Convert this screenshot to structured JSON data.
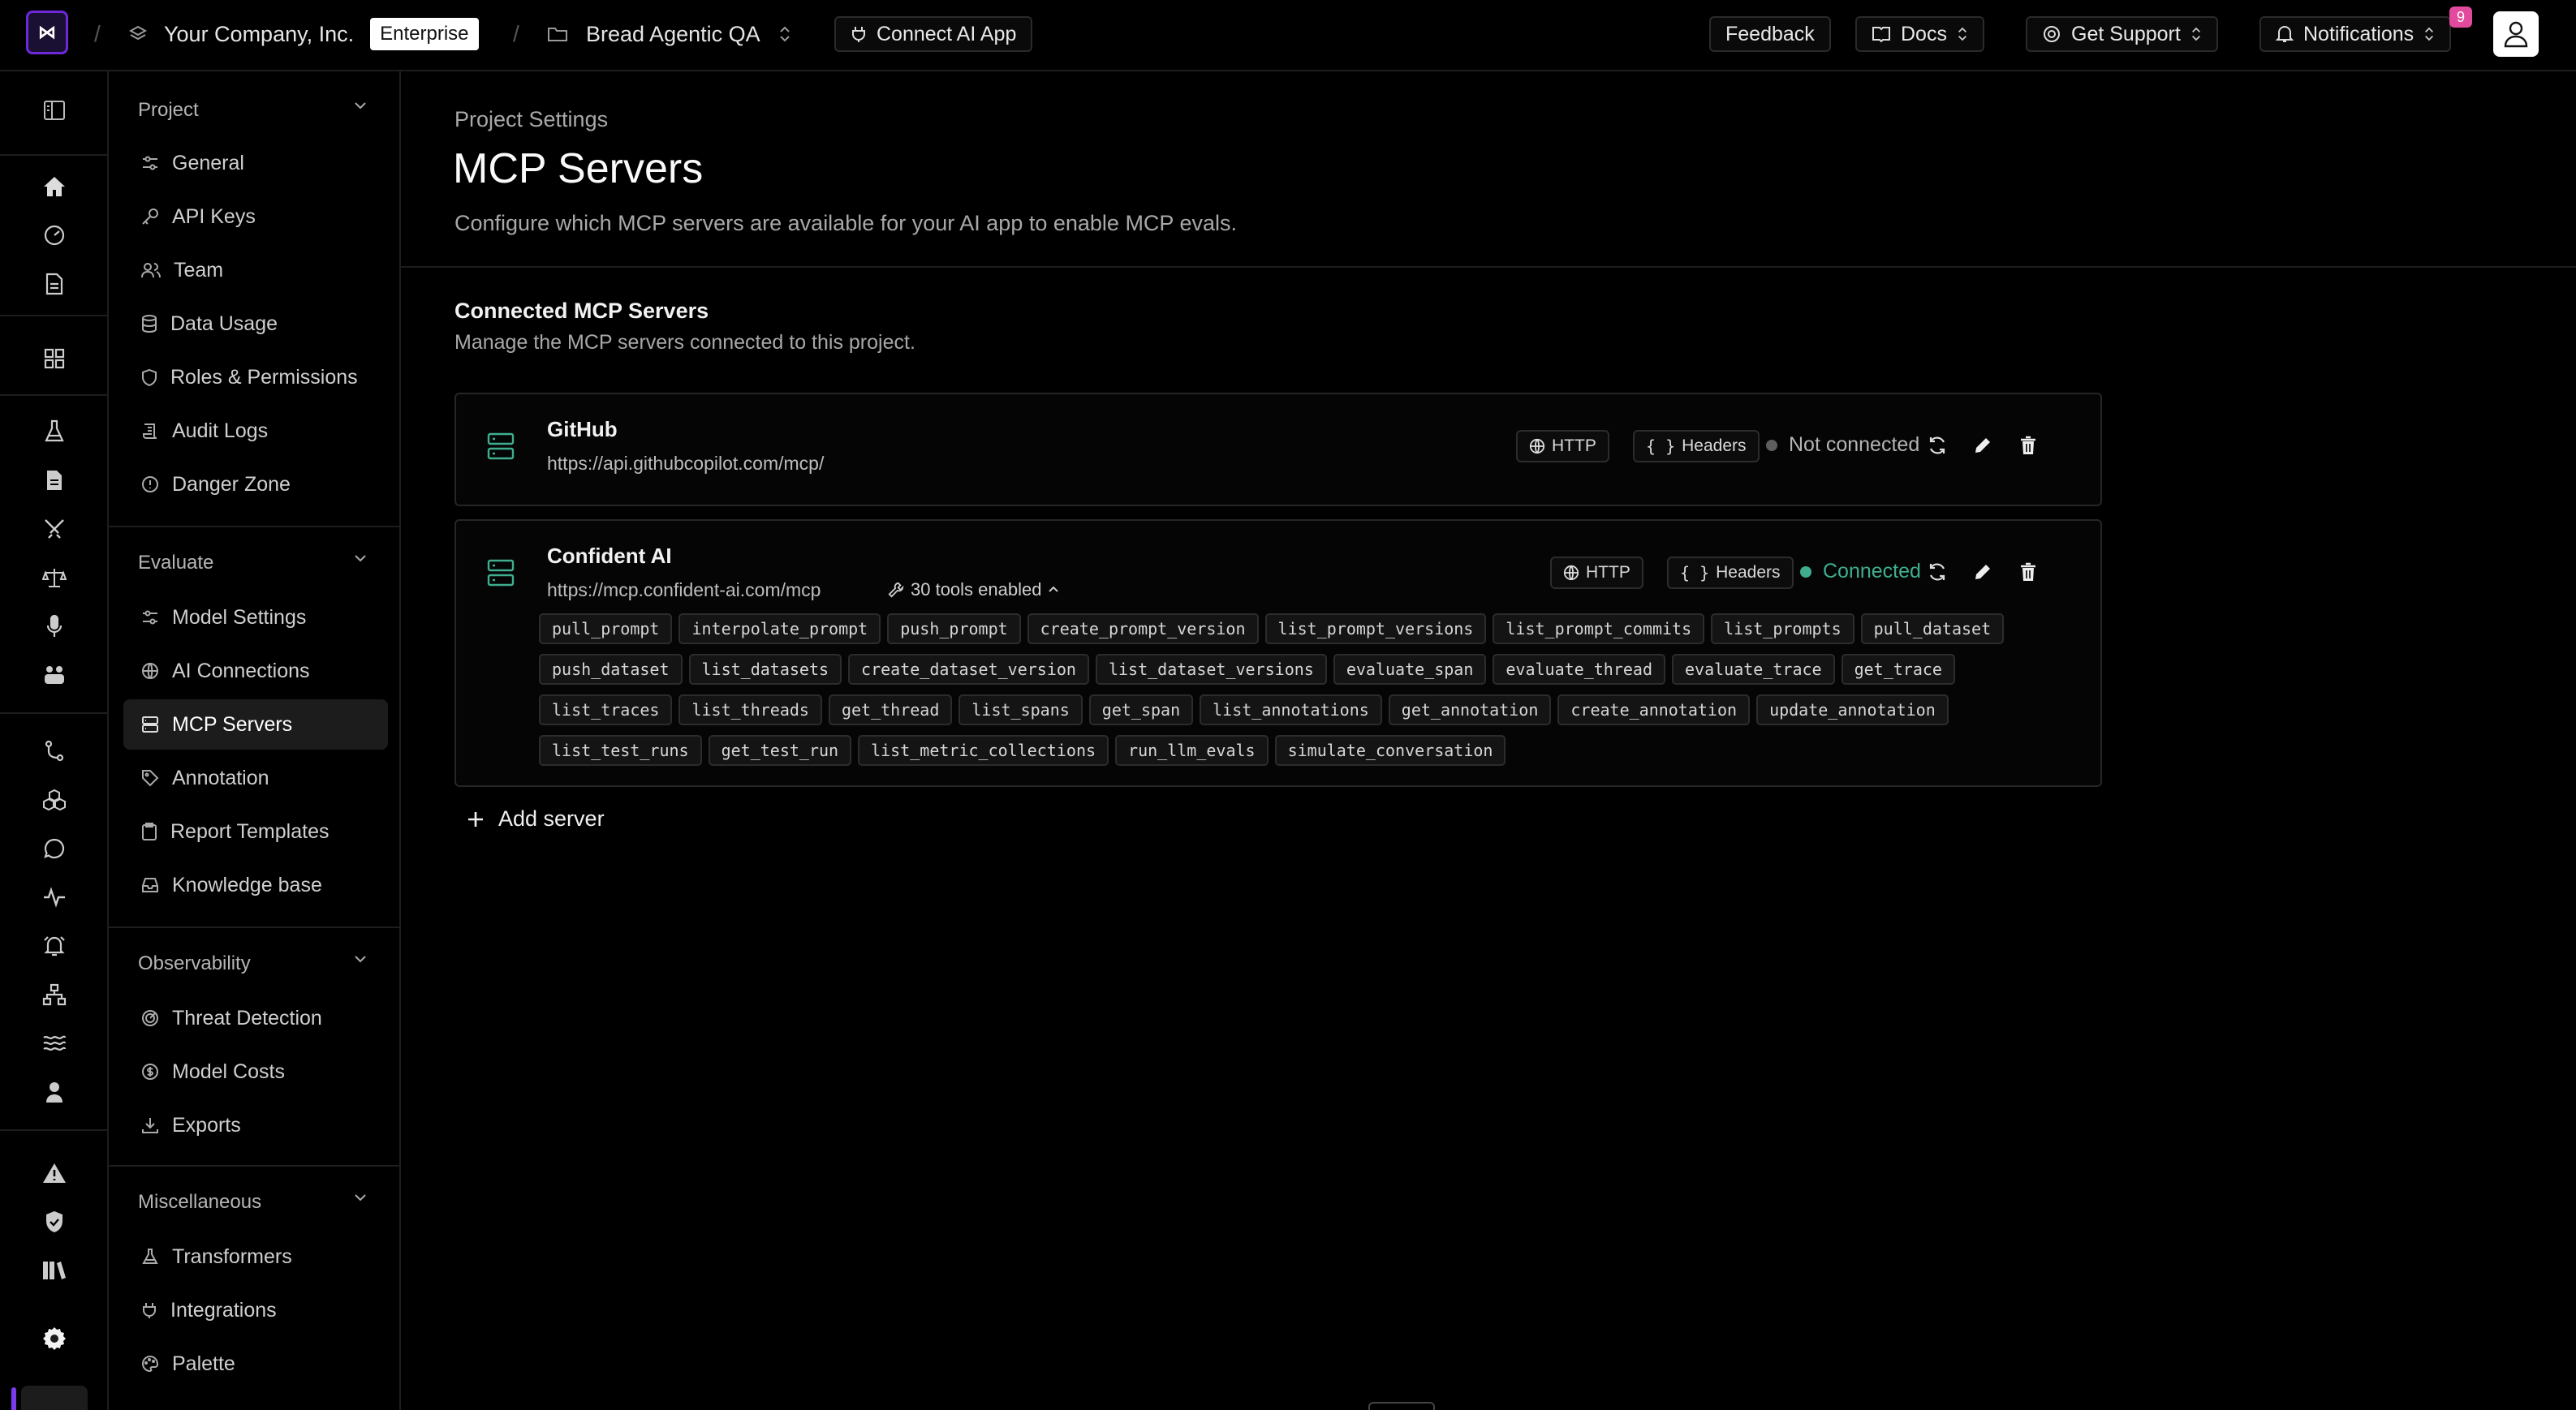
{
  "topbar": {
    "logo_text": "⋈",
    "company": "Your Company, Inc.",
    "plan_badge": "Enterprise",
    "project": "Bread Agentic QA",
    "connect_button": "Connect AI App",
    "feedback": "Feedback",
    "docs": "Docs",
    "support": "Get Support",
    "notifications": "Notifications",
    "notification_count": "9"
  },
  "nav": {
    "sections": [
      {
        "title": "Project",
        "items": [
          "General",
          "API Keys",
          "Team",
          "Data Usage",
          "Roles & Permissions",
          "Audit Logs",
          "Danger Zone"
        ]
      },
      {
        "title": "Evaluate",
        "items": [
          "Model Settings",
          "AI Connections",
          "MCP Servers",
          "Annotation",
          "Report Templates",
          "Knowledge base"
        ]
      },
      {
        "title": "Observability",
        "items": [
          "Threat Detection",
          "Model Costs",
          "Exports"
        ]
      },
      {
        "title": "Miscellaneous",
        "items": [
          "Transformers",
          "Integrations",
          "Palette"
        ]
      }
    ],
    "active_item": "MCP Servers"
  },
  "main": {
    "breadcrumb": "Project Settings",
    "title": "MCP Servers",
    "description": "Configure which MCP servers are available for your AI app to enable MCP evals.",
    "section_title": "Connected MCP Servers",
    "section_desc": "Manage the MCP servers connected to this project.",
    "add_server": "Add server"
  },
  "servers": [
    {
      "name": "GitHub",
      "url": "https://api.githubcopilot.com/mcp/",
      "transport": "HTTP",
      "headers_label": "Headers",
      "status": "Not connected",
      "status_color": "#6b6b6b"
    },
    {
      "name": "Confident AI",
      "url": "https://mcp.confident-ai.com/mcp",
      "tools_enabled": "30 tools enabled",
      "transport": "HTTP",
      "headers_label": "Headers",
      "status": "Connected",
      "status_color": "#3fae8f",
      "tools": [
        "pull_prompt",
        "interpolate_prompt",
        "push_prompt",
        "create_prompt_version",
        "list_prompt_versions",
        "list_prompt_commits",
        "list_prompts",
        "pull_dataset",
        "push_dataset",
        "list_datasets",
        "create_dataset_version",
        "list_dataset_versions",
        "evaluate_span",
        "evaluate_thread",
        "evaluate_trace",
        "get_trace",
        "list_traces",
        "list_threads",
        "get_thread",
        "list_spans",
        "get_span",
        "list_annotations",
        "get_annotation",
        "create_annotation",
        "update_annotation",
        "list_test_runs",
        "get_test_run",
        "list_metric_collections",
        "run_llm_evals",
        "simulate_conversation"
      ]
    }
  ],
  "colors": {
    "accent": "#7c3aed",
    "connected": "#3fae8f",
    "badge": "#e24a9e"
  }
}
